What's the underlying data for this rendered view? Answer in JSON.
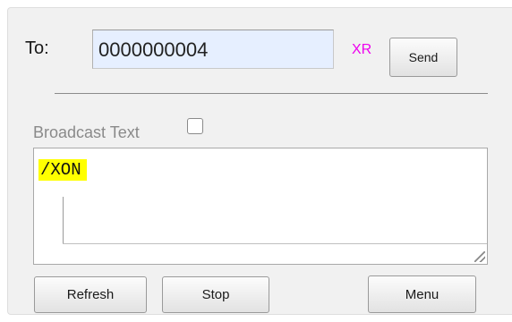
{
  "header": {
    "to_label": "To:",
    "to_value": "0000000004",
    "xr_label": "XR",
    "send_label": "Send"
  },
  "broadcast": {
    "label": "Broadcast Text",
    "checked": false
  },
  "message": {
    "text": "/XON",
    "highlight_color": "#ffff00"
  },
  "footer": {
    "refresh_label": "Refresh",
    "stop_label": "Stop",
    "menu_label": "Menu"
  },
  "colors": {
    "panel_bg": "#f1f1f1",
    "input_bg": "#e6efff",
    "xr_color": "#ee00ee"
  }
}
